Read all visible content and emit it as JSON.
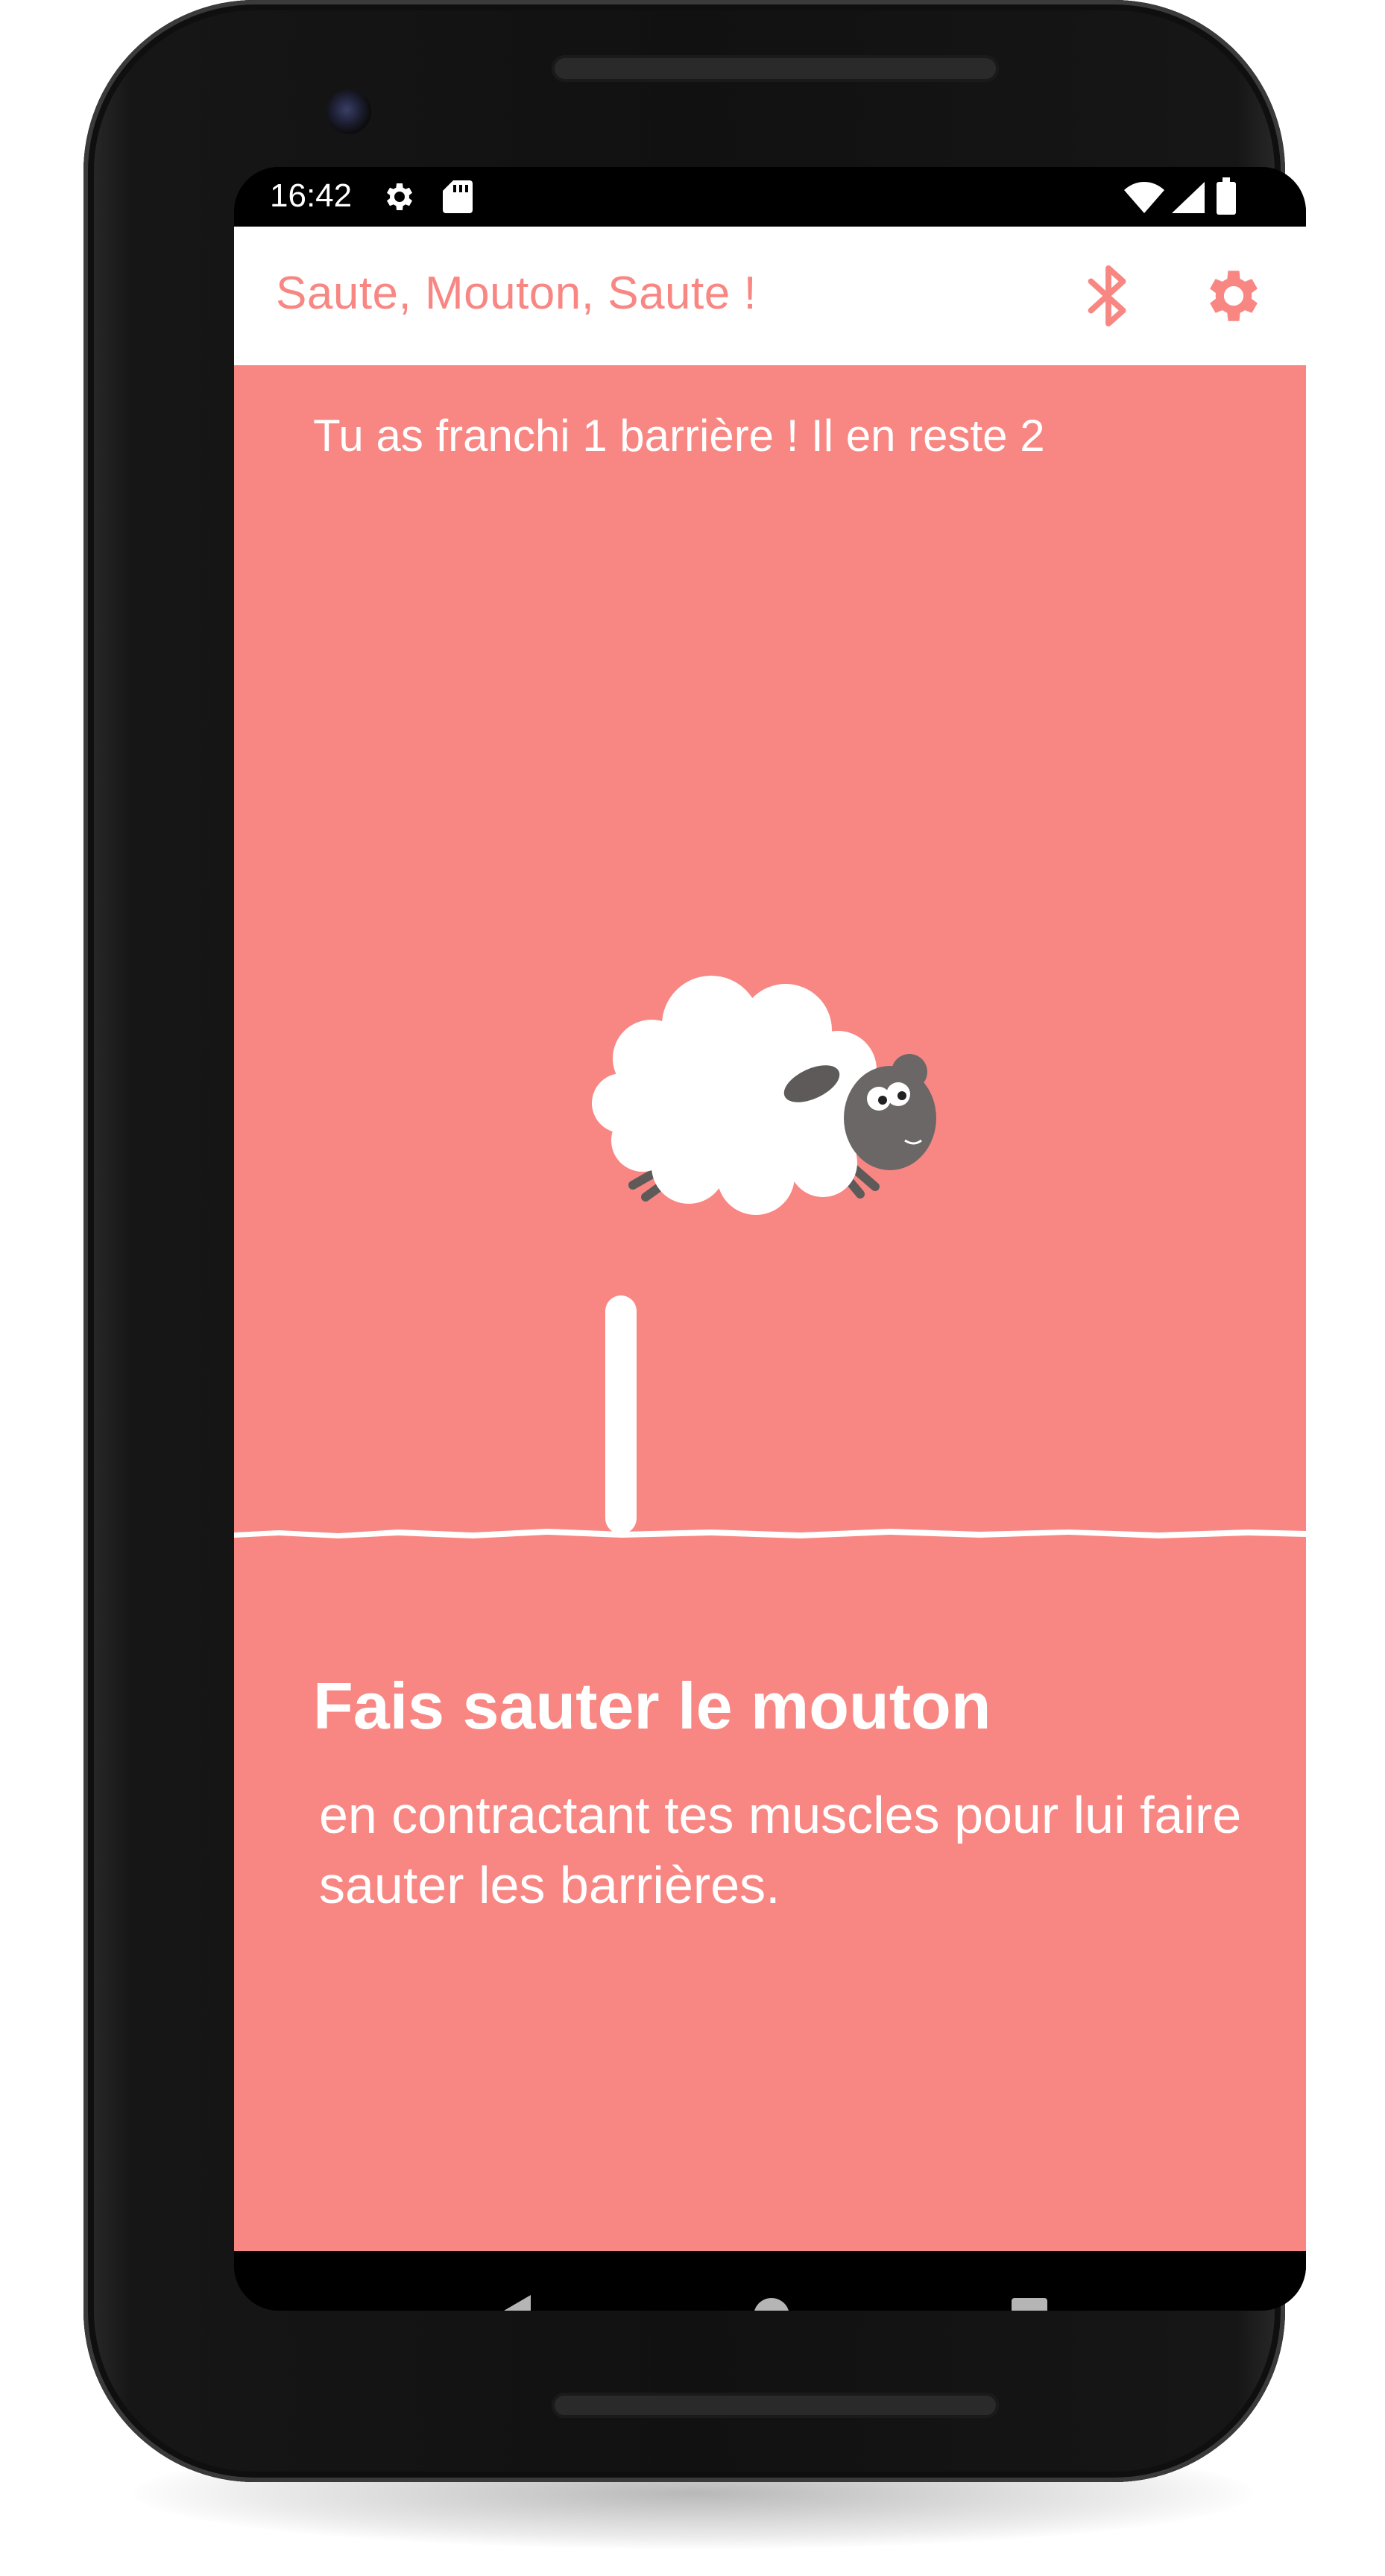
{
  "status_bar": {
    "time": "16:42",
    "icons": [
      "settings-gear-icon",
      "sd-card-icon",
      "wifi-icon",
      "signal-icon",
      "battery-icon"
    ]
  },
  "app_bar": {
    "title": "Saute, Mouton, Saute !",
    "actions": [
      "bluetooth-icon",
      "settings-icon"
    ],
    "accent_color": "#F88783"
  },
  "game": {
    "progress_text": "Tu as franchi 1 barrière ! Il en reste 2",
    "background_color": "#F88783"
  },
  "instructions": {
    "title": "Fais sauter le mouton",
    "body": "en contractant tes muscles pour lui faire sauter les barrières."
  },
  "nav_bar": {
    "buttons": [
      "back-icon",
      "home-icon",
      "recents-icon"
    ]
  }
}
